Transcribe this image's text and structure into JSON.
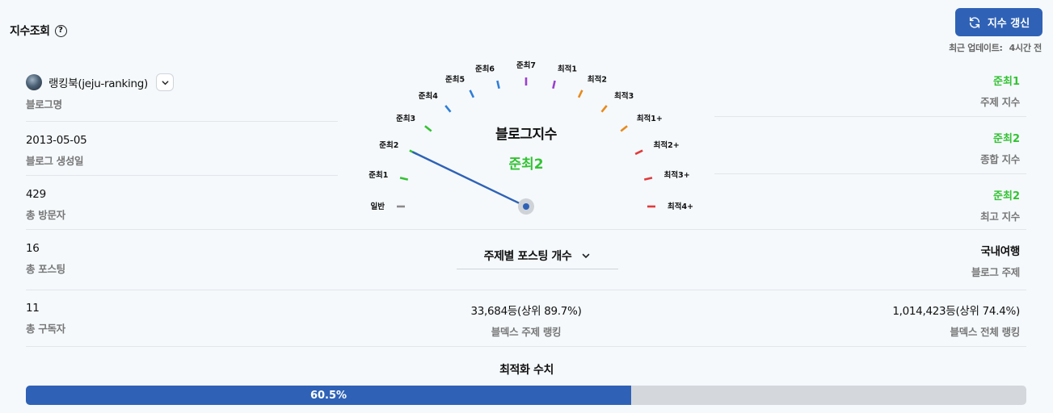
{
  "header": {
    "title": "지수조회",
    "help_glyph": "?",
    "refresh_label": "지수 갱신",
    "updated_label": "최근 업데이트:",
    "updated_value": "4시간 전"
  },
  "left": {
    "blog_name_value": "랭킹북(jeju-ranking)",
    "blog_name_label": "블로그명",
    "created_value": "2013-05-05",
    "created_label": "블로그 생성일",
    "visitors_value": "429",
    "visitors_label": "총 방문자",
    "posts_value": "16",
    "posts_label": "총 포스팅",
    "subscribers_value": "11",
    "subscribers_label": "총 구독자"
  },
  "right": {
    "topic_index_value": "준최1",
    "topic_index_label": "주제 지수",
    "overall_index_value": "준최2",
    "overall_index_label": "종합 지수",
    "max_index_value": "준최2",
    "max_index_label": "최고 지수",
    "blog_topic_value": "국내여행",
    "blog_topic_label": "블로그 주제",
    "total_rank_value": "1,014,423등(상위 74.4%)",
    "total_rank_label": "블덱스 전체 랭킹"
  },
  "gauge": {
    "title": "블로그지수",
    "current": "준최2",
    "current_index": 2,
    "ticks": [
      {
        "label": "일반",
        "color": "#8a8a8a"
      },
      {
        "label": "준최1",
        "color": "#34c234"
      },
      {
        "label": "준최2",
        "color": "#34c234"
      },
      {
        "label": "준최3",
        "color": "#34c234"
      },
      {
        "label": "준최4",
        "color": "#2f7ed8"
      },
      {
        "label": "준최5",
        "color": "#2f7ed8"
      },
      {
        "label": "준최6",
        "color": "#2f7ed8"
      },
      {
        "label": "준최7",
        "color": "#9b3fd1"
      },
      {
        "label": "최적1",
        "color": "#9b3fd1"
      },
      {
        "label": "최적2",
        "color": "#e8891c"
      },
      {
        "label": "최적3",
        "color": "#e8891c"
      },
      {
        "label": "최적1+",
        "color": "#e8891c"
      },
      {
        "label": "최적2+",
        "color": "#e23a3a"
      },
      {
        "label": "최적3+",
        "color": "#e23a3a"
      },
      {
        "label": "최적4+",
        "color": "#e23a3a"
      }
    ],
    "needle_color": "#2f62b6"
  },
  "center": {
    "topic_select_label": "주제별 포스팅 개수",
    "topic_rank_value": "33,684등(상위 89.7%)",
    "topic_rank_label": "블덱스 주제 랭킹"
  },
  "optimization": {
    "title": "최적화 수치",
    "percent_label": "60.5%",
    "fraction": 0.605
  }
}
